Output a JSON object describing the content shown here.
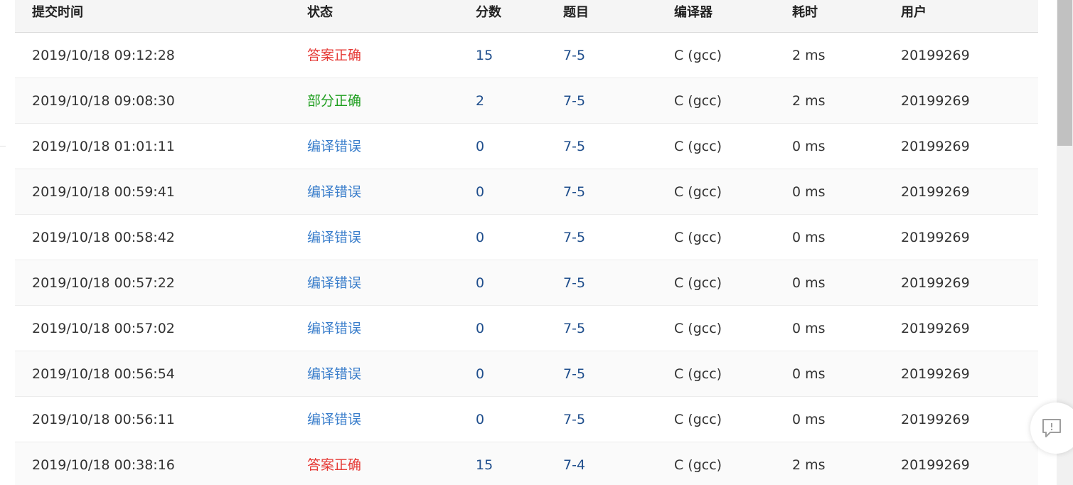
{
  "table": {
    "headers": {
      "time": "提交时间",
      "status": "状态",
      "score": "分数",
      "problem": "题目",
      "compiler": "编译器",
      "cost": "耗时",
      "user": "用户"
    },
    "rows": [
      {
        "time": "2019/10/18 09:12:28",
        "status": "答案正确",
        "status_type": "accepted",
        "score": "15",
        "problem": "7-5",
        "compiler": "C (gcc)",
        "cost": "2 ms",
        "user": "20199269"
      },
      {
        "time": "2019/10/18 09:08:30",
        "status": "部分正确",
        "status_type": "partial",
        "score": "2",
        "problem": "7-5",
        "compiler": "C (gcc)",
        "cost": "2 ms",
        "user": "20199269"
      },
      {
        "time": "2019/10/18 01:01:11",
        "status": "编译错误",
        "status_type": "compile-error",
        "score": "0",
        "problem": "7-5",
        "compiler": "C (gcc)",
        "cost": "0 ms",
        "user": "20199269"
      },
      {
        "time": "2019/10/18 00:59:41",
        "status": "编译错误",
        "status_type": "compile-error",
        "score": "0",
        "problem": "7-5",
        "compiler": "C (gcc)",
        "cost": "0 ms",
        "user": "20199269"
      },
      {
        "time": "2019/10/18 00:58:42",
        "status": "编译错误",
        "status_type": "compile-error",
        "score": "0",
        "problem": "7-5",
        "compiler": "C (gcc)",
        "cost": "0 ms",
        "user": "20199269"
      },
      {
        "time": "2019/10/18 00:57:22",
        "status": "编译错误",
        "status_type": "compile-error",
        "score": "0",
        "problem": "7-5",
        "compiler": "C (gcc)",
        "cost": "0 ms",
        "user": "20199269"
      },
      {
        "time": "2019/10/18 00:57:02",
        "status": "编译错误",
        "status_type": "compile-error",
        "score": "0",
        "problem": "7-5",
        "compiler": "C (gcc)",
        "cost": "0 ms",
        "user": "20199269"
      },
      {
        "time": "2019/10/18 00:56:54",
        "status": "编译错误",
        "status_type": "compile-error",
        "score": "0",
        "problem": "7-5",
        "compiler": "C (gcc)",
        "cost": "0 ms",
        "user": "20199269"
      },
      {
        "time": "2019/10/18 00:56:11",
        "status": "编译错误",
        "status_type": "compile-error",
        "score": "0",
        "problem": "7-5",
        "compiler": "C (gcc)",
        "cost": "0 ms",
        "user": "20199269"
      },
      {
        "time": "2019/10/18 00:38:16",
        "status": "答案正确",
        "status_type": "accepted",
        "score": "15",
        "problem": "7-4",
        "compiler": "C (gcc)",
        "cost": "2 ms",
        "user": "20199269"
      }
    ]
  },
  "colors": {
    "accepted": "#e53935",
    "partial": "#1e9e1e",
    "compile_error": "#3a7ecb",
    "link": "#1f4e8c",
    "header_bg": "#f5f5f5"
  },
  "icons": {
    "feedback": "feedback-chat-icon"
  }
}
